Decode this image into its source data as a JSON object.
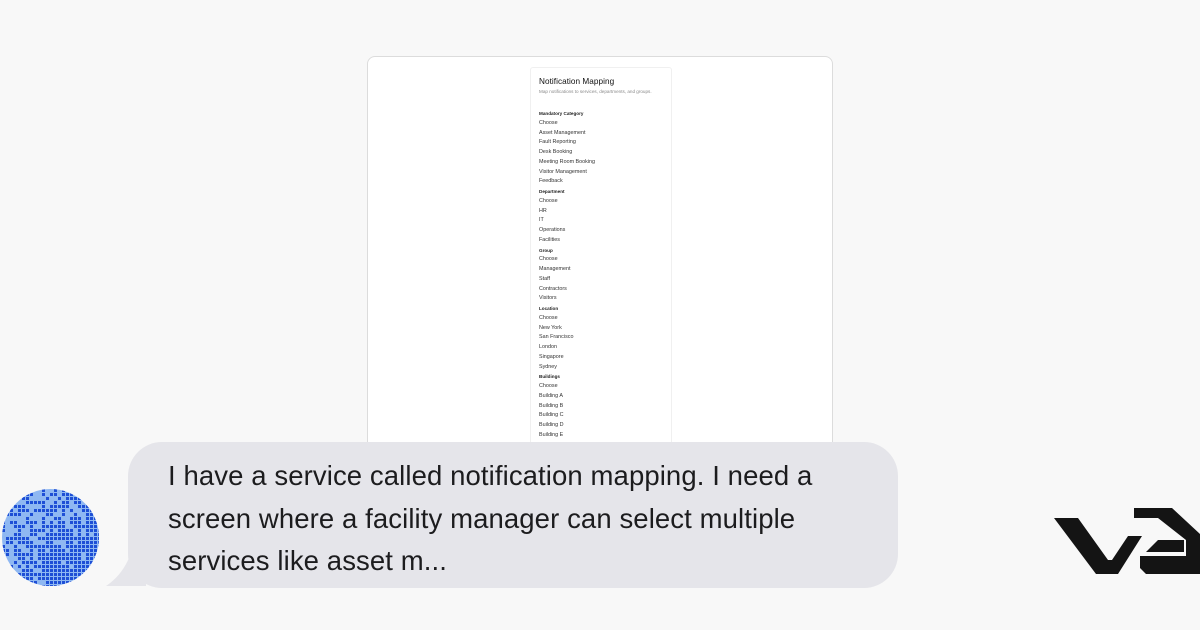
{
  "preview": {
    "title": "Notification Mapping",
    "subtitle": "Map notifications to services, departments, and groups.",
    "sections": [
      {
        "label": "Mandatory Category",
        "options": [
          "Choose",
          "Asset Management",
          "Fault Reporting",
          "Desk Booking",
          "Meeting Room Booking",
          "Visitor Management",
          "Feedback"
        ]
      },
      {
        "label": "Department",
        "options": [
          "Choose",
          "HR",
          "IT",
          "Operations",
          "Facilities"
        ]
      },
      {
        "label": "Group",
        "options": [
          "Choose",
          "Management",
          "Staff",
          "Contractors",
          "Visitors"
        ]
      },
      {
        "label": "Location",
        "options": [
          "Choose",
          "New York",
          "San Francisco",
          "London",
          "Singapore",
          "Sydney"
        ]
      },
      {
        "label": "Buildings",
        "options": [
          "Choose",
          "Building A",
          "Building B",
          "Building C",
          "Building D",
          "Building E"
        ]
      }
    ]
  },
  "chat": {
    "message": "I have a service called notification mapping. I need a screen where a facility manager can select multiple services like asset m..."
  },
  "colors": {
    "background": "#f8f8f8",
    "bubble": "#e5e5ea",
    "avatar_light": "#8fb8f2",
    "avatar_dark": "#1e4fd6",
    "logo": "#141414"
  },
  "icons": {
    "avatar": "pixel-gradient-avatar-icon",
    "logo": "brand-logo-icon"
  }
}
